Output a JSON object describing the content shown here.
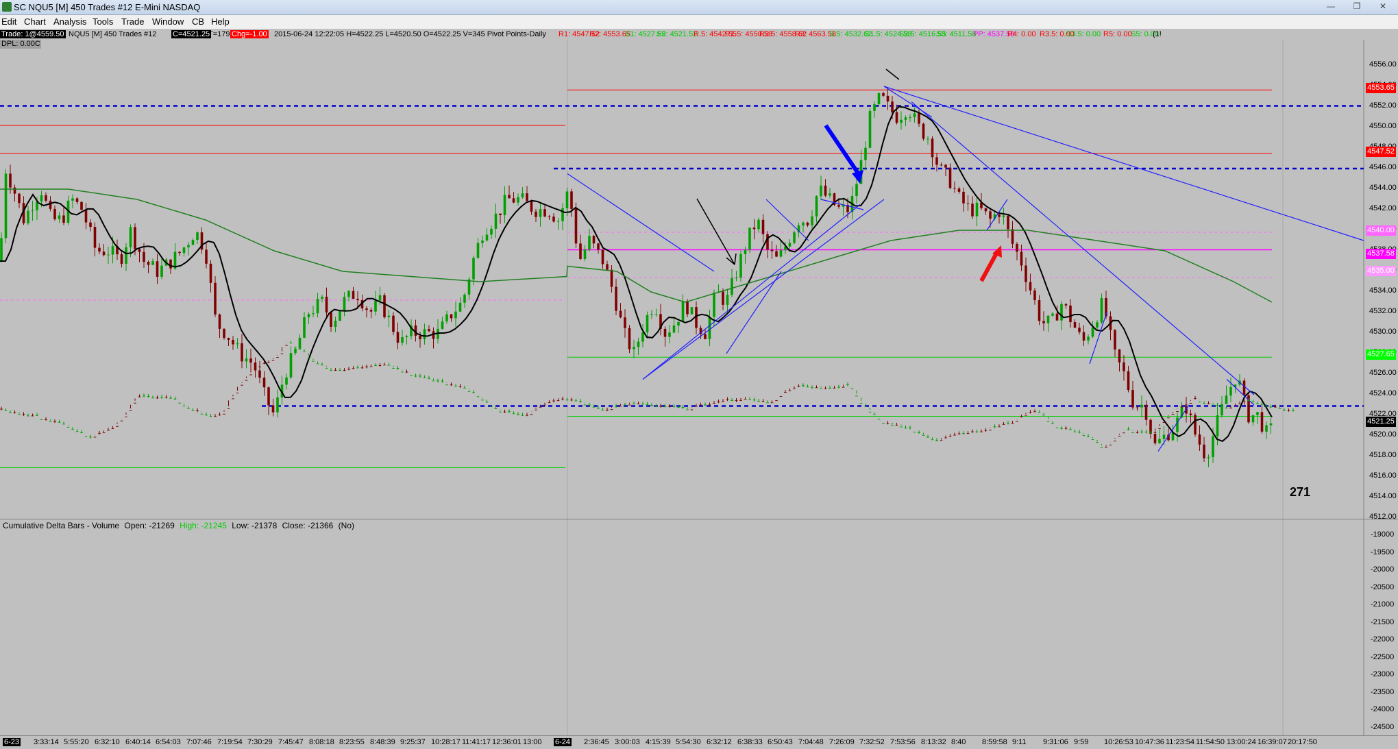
{
  "window": {
    "title": "SC NQU5 [M]  450 Trades  #12  E-Mini NASDAQ",
    "minimize": "—",
    "maximize": "❐",
    "close": "✕"
  },
  "menu": [
    "Edit",
    "Chart",
    "Analysis",
    "Tools",
    "Trade",
    "Window",
    "CB",
    "Help"
  ],
  "status": {
    "trade": "Trade: 1@4559.50",
    "symbol": "NQU5 [M]  450 Trades  #12",
    "last": "C=4521.25",
    "ticks": "T=179",
    "change": "Chg=-1.00",
    "info": "2015-06-24 12:22:05 H=4522.25 L=4520.50 O=4522.25 V=345 Pivot Points-Daily",
    "pivots": [
      {
        "label": "R1: 4547.52",
        "color": "#ff0000"
      },
      {
        "label": "R2: 4553.65",
        "color": "#ff0000"
      },
      {
        "label": "S1: 4527.65",
        "color": "#00cc00"
      },
      {
        "label": "S2: 4521.52",
        "color": "#00cc00"
      },
      {
        "label": "R.5: 4542.55",
        "color": "#ff0000"
      },
      {
        "label": "R1.5: 4550.58",
        "color": "#ff0000"
      },
      {
        "label": "R2.5: 4558.62",
        "color": "#ff0000"
      },
      {
        "label": "R3: 4563.58",
        "color": "#ff0000"
      },
      {
        "label": "S.5: 4532.62",
        "color": "#00cc00"
      },
      {
        "label": "S1.5: 4524.58",
        "color": "#00cc00"
      },
      {
        "label": "S2.5: 4516.55",
        "color": "#00cc00"
      },
      {
        "label": "S3: 4511.58",
        "color": "#00cc00"
      },
      {
        "label": "PP: 4537.58",
        "color": "#ff00ff"
      },
      {
        "label": "R4: 0.00",
        "color": "#ff0000"
      },
      {
        "label": "R3.5: 0.00",
        "color": "#ff0000"
      },
      {
        "label": "S3.5: 0.00",
        "color": "#00cc00"
      },
      {
        "label": "R5: 0.00",
        "color": "#ff0000"
      },
      {
        "label": "S5: 0.00",
        "color": "#00cc00"
      },
      {
        "label": "(1!",
        "color": "#000000"
      }
    ]
  },
  "dpl": "DPL: 0.00C",
  "price_axis": [
    "4556.00",
    "4554.00",
    "4552.00",
    "4550.00",
    "4548.00",
    "4546.00",
    "4544.00",
    "4542.00",
    "4540.00",
    "4538.00",
    "4536.00",
    "4534.00",
    "4532.00",
    "4530.00",
    "4528.00",
    "4526.00",
    "4524.00",
    "4522.00",
    "4520.00",
    "4518.00",
    "4516.00",
    "4514.00",
    "4512.00"
  ],
  "price_tags": [
    {
      "text": "4553.65",
      "bg": "#ff0000",
      "fg": "#ffffff"
    },
    {
      "text": "4547.52",
      "bg": "#ff0000",
      "fg": "#ffffff"
    },
    {
      "text": "4540.00",
      "bg": "#ff66ff",
      "fg": "#ffffff"
    },
    {
      "text": "4537.58",
      "bg": "#ff00ff",
      "fg": "#ffffff"
    },
    {
      "text": "4535.00",
      "bg": "#ff99ff",
      "fg": "#ffffff"
    },
    {
      "text": "4527.65",
      "bg": "#00ff00",
      "fg": "#ffffff"
    },
    {
      "text": "4521.25",
      "bg": "#000000",
      "fg": "#ffffff"
    }
  ],
  "lower_axis": [
    "-19000",
    "-19500",
    "-20000",
    "-20500",
    "-21000",
    "-21500",
    "-22000",
    "-22500",
    "-23000",
    "-23500",
    "-24000",
    "-24500"
  ],
  "lower_study": {
    "name": "Cumulative Delta Bars - Volume",
    "open": "Open: -21269",
    "high": "High: -21245",
    "low": "Low: -21378",
    "close": "Close: -21366",
    "flag": "(No)"
  },
  "bar_counter": "271",
  "time_axis": [
    "6-23",
    "3:33:14",
    "5:55:20",
    "6:32:10",
    "6:40:14",
    "6:54:03",
    "7:07:46",
    "7:19:54",
    "7:30:29",
    "7:45:47",
    "8:08:18",
    "8:23:55",
    "8:48:39",
    "9:25:37",
    "10:28:17",
    "11:41:17",
    "12:36:01",
    "13:00",
    "6-24",
    "2:36:45",
    "3:00:03",
    "4:15:39",
    "5:54:30",
    "6:32:12",
    "6:38:33",
    "6:50:43",
    "7:04:48",
    "7:26:09",
    "7:32:52",
    "7:53:56",
    "8:13:32",
    "8:40",
    "8:59:58",
    "9:11",
    "9:31:06",
    "9:59",
    "10:26:53",
    "10:47:36",
    "11:23:54",
    "11:54:50",
    "13:00:24",
    "16:39:07",
    "20:17:50"
  ],
  "colors": {
    "background": "#c0c0c0",
    "up_bar": "#00a000",
    "down_bar": "#800000",
    "ma_short": "#000000",
    "ma_long": "#208020",
    "trendline": "#2020ff"
  }
}
